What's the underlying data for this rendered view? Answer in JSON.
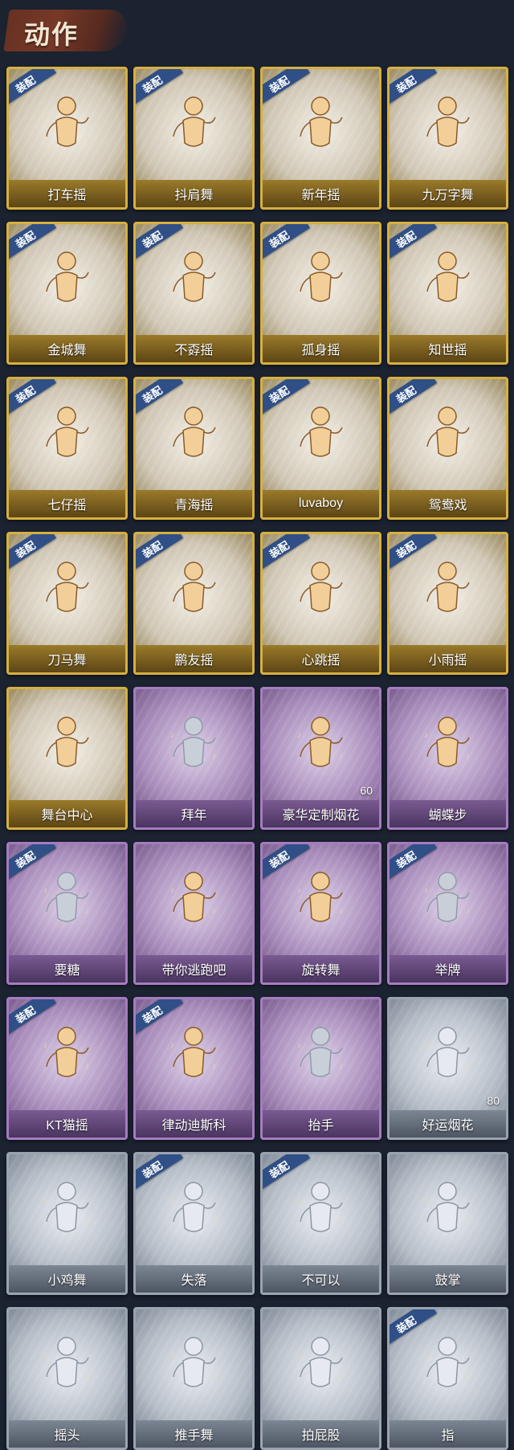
{
  "header": {
    "title": "动作"
  },
  "equipped_label": "装配",
  "cards": [
    {
      "label": "打车摇",
      "tier": "gold",
      "equipped": true
    },
    {
      "label": "抖肩舞",
      "tier": "gold",
      "equipped": true
    },
    {
      "label": "新年摇",
      "tier": "gold",
      "equipped": true
    },
    {
      "label": "九万字舞",
      "tier": "gold",
      "equipped": true
    },
    {
      "label": "金城舞",
      "tier": "gold",
      "equipped": true
    },
    {
      "label": "不孬摇",
      "tier": "gold",
      "equipped": true
    },
    {
      "label": "孤身摇",
      "tier": "gold",
      "equipped": true
    },
    {
      "label": "知世摇",
      "tier": "gold",
      "equipped": true
    },
    {
      "label": "七仔摇",
      "tier": "gold",
      "equipped": true
    },
    {
      "label": "青海摇",
      "tier": "gold",
      "equipped": true
    },
    {
      "label": "luvaboy",
      "tier": "gold",
      "equipped": true
    },
    {
      "label": "鸳鸯戏",
      "tier": "gold",
      "equipped": true
    },
    {
      "label": "刀马舞",
      "tier": "gold",
      "equipped": true
    },
    {
      "label": "鹏友摇",
      "tier": "gold",
      "equipped": true
    },
    {
      "label": "心跳摇",
      "tier": "gold",
      "equipped": true
    },
    {
      "label": "小雨摇",
      "tier": "gold",
      "equipped": true
    },
    {
      "label": "舞台中心",
      "tier": "gold",
      "equipped": false
    },
    {
      "label": "拜年",
      "tier": "purple",
      "equipped": false,
      "dim": true
    },
    {
      "label": "豪华定制烟花",
      "tier": "purple",
      "equipped": false,
      "count": "60"
    },
    {
      "label": "蝴蝶步",
      "tier": "purple",
      "equipped": false
    },
    {
      "label": "要糖",
      "tier": "purple",
      "equipped": true,
      "dim": true
    },
    {
      "label": "带你逃跑吧",
      "tier": "purple",
      "equipped": false
    },
    {
      "label": "旋转舞",
      "tier": "purple",
      "equipped": true
    },
    {
      "label": "举牌",
      "tier": "purple",
      "equipped": true,
      "dim": true
    },
    {
      "label": "KT猫摇",
      "tier": "purple",
      "equipped": true
    },
    {
      "label": "律动迪斯科",
      "tier": "purple",
      "equipped": true
    },
    {
      "label": "抬手",
      "tier": "purple",
      "equipped": false,
      "dim": true
    },
    {
      "label": "好运烟花",
      "tier": "silver",
      "equipped": false,
      "count": "80"
    },
    {
      "label": "小鸡舞",
      "tier": "silver",
      "equipped": false
    },
    {
      "label": "失落",
      "tier": "silver",
      "equipped": true
    },
    {
      "label": "不可以",
      "tier": "silver",
      "equipped": true
    },
    {
      "label": "鼓掌",
      "tier": "silver",
      "equipped": false
    },
    {
      "label": "摇头",
      "tier": "silver",
      "equipped": false
    },
    {
      "label": "推手舞",
      "tier": "silver",
      "equipped": false
    },
    {
      "label": "拍屁股",
      "tier": "silver",
      "equipped": false
    },
    {
      "label": "指",
      "tier": "silver",
      "equipped": true
    }
  ]
}
